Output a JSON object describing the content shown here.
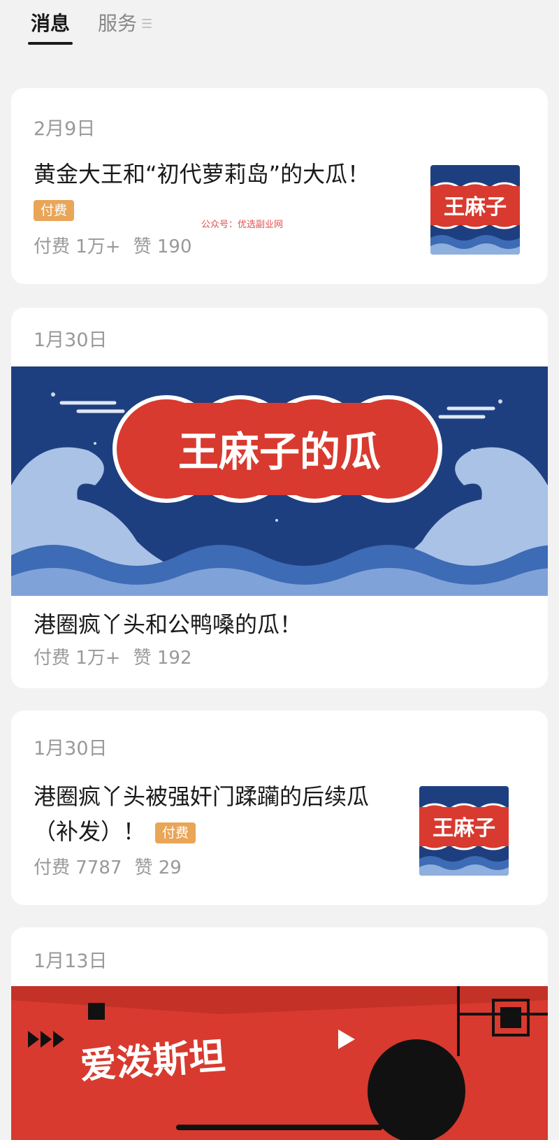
{
  "tabs": {
    "active": "消息",
    "inactive": "服务"
  },
  "watermark": "公众号：优选副业网",
  "posts": [
    {
      "date": "2月9日",
      "title": "黄金大王和“初代萝莉岛”的大瓜！",
      "badge": "付费",
      "paid": "付费 1万+",
      "likes": "赞 190",
      "thumb_text": "王麻子"
    },
    {
      "date": "1月30日",
      "title": "港圈疯丫头和公鸭嗓的瓜！",
      "paid": "付费 1万+",
      "likes": "赞 192",
      "banner_text": "王麻子的瓜"
    },
    {
      "date": "1月30日",
      "title_line1": "港圈疯丫头被强奸门蹂躏的后续瓜",
      "title_line2": "（补发）！",
      "badge": "付费",
      "paid": "付费 7787",
      "likes": "赞 29",
      "thumb_text": "王麻子"
    },
    {
      "date": "1月13日",
      "banner_text": "爱泼斯坦"
    }
  ],
  "colors": {
    "badge": "#e9a558",
    "navy": "#1e3f7f",
    "red": "#d83a2f"
  }
}
